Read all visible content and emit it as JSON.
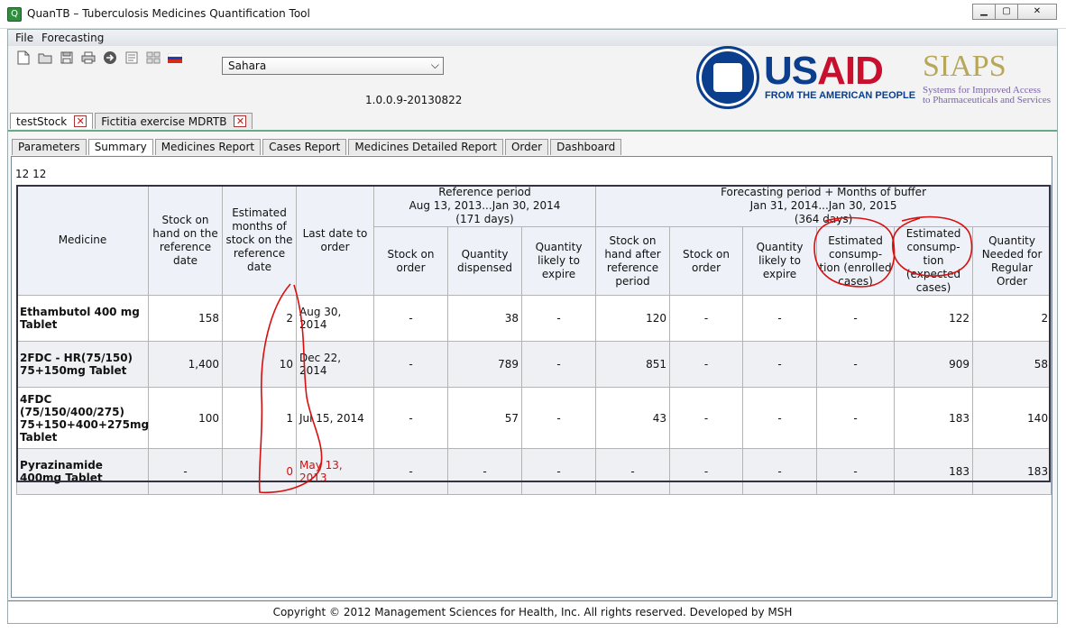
{
  "window": {
    "title": "QuanTB – Tuberculosis Medicines Quantification Tool",
    "app_icon": "Q",
    "buttons": [
      "▁",
      "▢",
      "✕"
    ]
  },
  "menu": [
    "File",
    "Forecasting"
  ],
  "toolbar": [
    "new-file-icon",
    "open-folder-icon",
    "save-icon",
    "print-icon",
    "go-arrow-icon",
    "report-icon",
    "grid-icon",
    "russian-flag-icon"
  ],
  "region": {
    "selected": "Sahara"
  },
  "version": "1.0.0.9-20130822",
  "logos": {
    "usaid_us": "US",
    "usaid_aid": "AID",
    "usaid_tagline": "FROM THE AMERICAN PEOPLE",
    "siaps": "SIAPS",
    "siaps_tagline_1": "Systems for Improved Access",
    "siaps_tagline_2": "to Pharmaceuticals and Services"
  },
  "doc_tabs": [
    {
      "label": "testStock",
      "active": true
    },
    {
      "label": "Fictitia exercise MDRTB",
      "active": false
    }
  ],
  "sub_tabs": [
    {
      "label": "Parameters",
      "active": false
    },
    {
      "label": "Summary",
      "active": true
    },
    {
      "label": "Medicines Report",
      "active": false
    },
    {
      "label": "Cases Report",
      "active": false
    },
    {
      "label": "Medicines Detailed Report",
      "active": false
    },
    {
      "label": "Order",
      "active": false
    },
    {
      "label": "Dashboard",
      "active": false
    }
  ],
  "counter": "12 12",
  "table": {
    "col_medicine": "Medicine",
    "col_stock_hand": "Stock on hand on the reference date",
    "col_est_months": "Estimated months of stock on the reference date",
    "col_last_date": "Last date to order",
    "ref_group_1": "Reference period",
    "ref_group_2": "Aug 13, 2013...Jan 30, 2014",
    "ref_group_3": "(171 days)",
    "fc_group_1": "Forecasting period + Months of buffer",
    "fc_group_2": "Jan 31, 2014...Jan 30, 2015",
    "fc_group_3": "(364 days)",
    "col_ref_stock_order": "Stock on order",
    "col_ref_qty_dispensed": "Quantity dispensed",
    "col_ref_qty_expire": "Quantity likely to expire",
    "col_fc_stock_after": "Stock on hand after reference period",
    "col_fc_stock_order": "Stock on order",
    "col_fc_qty_expire": "Quantity likely to expire",
    "col_fc_est_enrolled": "Estimated consump- tion (enrolled cases)",
    "col_fc_est_expected": "Estimated consump- tion (expected cases)",
    "col_fc_qty_needed": "Quantity Needed for Regular Order",
    "rows": [
      {
        "medicine": "Ethambutol 400 mg Tablet",
        "stock": "158",
        "months": "2",
        "last_date": "Aug 30, 2014",
        "ref_order": "-",
        "dispensed": "38",
        "ref_expire": "-",
        "after": "120",
        "fc_order": "-",
        "fc_expire": "-",
        "enrolled": "-",
        "expected": "122",
        "needed": "2",
        "warn": false
      },
      {
        "medicine": "2FDC - HR(75/150) 75+150mg Tablet",
        "stock": "1,400",
        "months": "10",
        "last_date": "Dec 22, 2014",
        "ref_order": "-",
        "dispensed": "789",
        "ref_expire": "-",
        "after": "851",
        "fc_order": "-",
        "fc_expire": "-",
        "enrolled": "-",
        "expected": "909",
        "needed": "58",
        "warn": false
      },
      {
        "medicine": "4FDC (75/150/400/275) 75+150+400+275mg Tablet",
        "stock": "100",
        "months": "1",
        "last_date": "Jul 15, 2014",
        "ref_order": "-",
        "dispensed": "57",
        "ref_expire": "-",
        "after": "43",
        "fc_order": "-",
        "fc_expire": "-",
        "enrolled": "-",
        "expected": "183",
        "needed": "140",
        "warn": false
      },
      {
        "medicine": "Pyrazinamide 400mg Tablet",
        "stock": "-",
        "months": "0",
        "last_date": "May 13, 2013",
        "ref_order": "-",
        "dispensed": "-",
        "ref_expire": "-",
        "after": "-",
        "fc_order": "-",
        "fc_expire": "-",
        "enrolled": "-",
        "expected": "183",
        "needed": "183",
        "warn": true
      }
    ]
  },
  "footer": "Copyright © 2012 Management Sciences for Health, Inc. All rights reserved. Developed by MSH"
}
